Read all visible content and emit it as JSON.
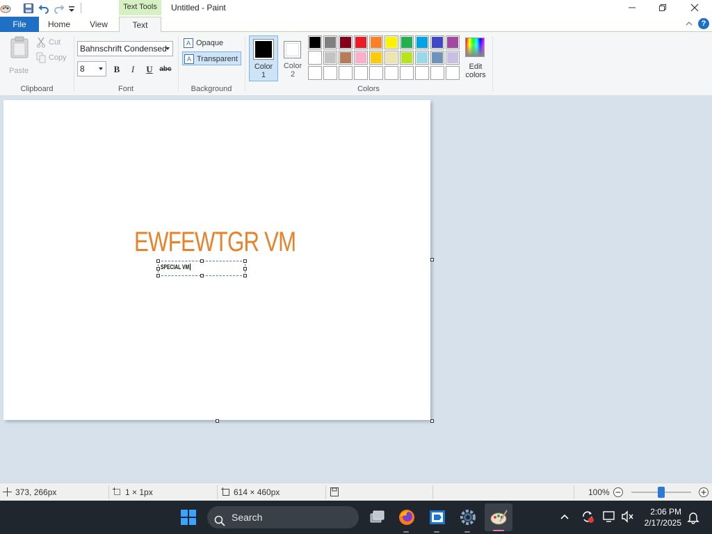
{
  "window": {
    "title": "Untitled - Paint",
    "contextual_tab_group": "Text Tools"
  },
  "tabs": [
    {
      "label": "File"
    },
    {
      "label": "Home"
    },
    {
      "label": "View"
    },
    {
      "label": "Text"
    }
  ],
  "clipboard": {
    "paste_label": "Paste",
    "cut_label": "Cut",
    "copy_label": "Copy",
    "group_label": "Clipboard"
  },
  "font": {
    "family": "Bahnschrift Condensed",
    "size": "8",
    "bold_label": "B",
    "italic_label": "I",
    "underline_label": "U",
    "strikethrough_label": "abc",
    "group_label": "Font"
  },
  "background": {
    "opaque_label": "Opaque",
    "transparent_label": "Transparent",
    "selected": "Transparent",
    "group_label": "Background"
  },
  "colors": {
    "color1_label_line1": "Color",
    "color1_label_line2": "1",
    "color2_label_line1": "Color",
    "color2_label_line2": "2",
    "color1_value": "#000000",
    "color2_value": "#ffffff",
    "edit_label_line1": "Edit",
    "edit_label_line2": "colors",
    "group_label": "Colors",
    "palette_row1": [
      "#000000",
      "#7f7f7f",
      "#880015",
      "#ed1c24",
      "#ff7f27",
      "#fff200",
      "#22b14c",
      "#00a2e8",
      "#3f48cc",
      "#a349a4"
    ],
    "palette_row2": [
      "#ffffff",
      "#c3c3c3",
      "#b97a57",
      "#ffaec9",
      "#ffc90e",
      "#efe4b0",
      "#b5e61d",
      "#99d9ea",
      "#7092be",
      "#c8bfe7"
    ],
    "palette_row3": [
      "#ffffff",
      "#ffffff",
      "#ffffff",
      "#ffffff",
      "#ffffff",
      "#ffffff",
      "#ffffff",
      "#ffffff",
      "#ffffff",
      "#ffffff"
    ]
  },
  "canvas": {
    "big_text": "EWFEWTGR VM",
    "big_text_color": "#e8822a",
    "small_text": "SPECIAL VM"
  },
  "statusbar": {
    "cursor_pos": "373, 266px",
    "selection_size": "1 × 1px",
    "canvas_size": "614 × 460px",
    "zoom": "100%"
  },
  "taskbar": {
    "search_placeholder": "Search",
    "time": "2:06 PM",
    "date": "2/17/2025"
  }
}
